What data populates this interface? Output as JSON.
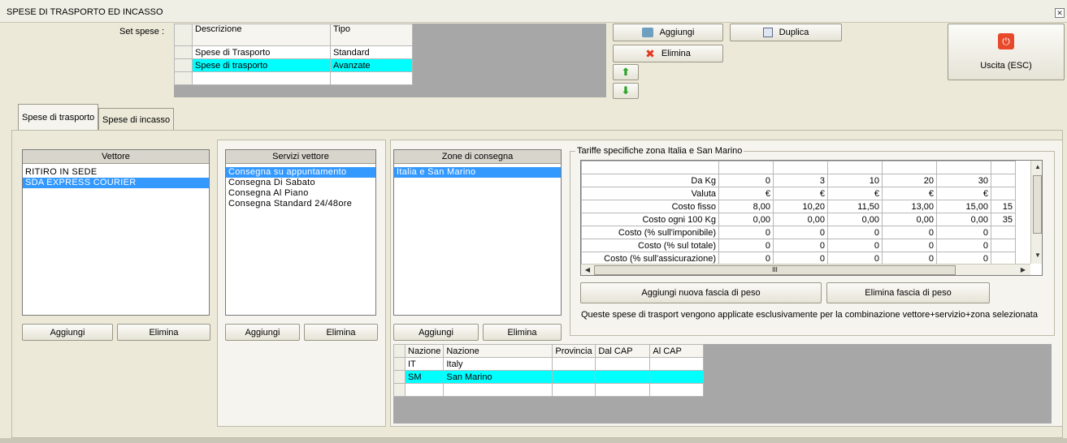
{
  "window": {
    "title": "SPESE DI TRASPORTO ED INCASSO"
  },
  "set_spese": {
    "label": "Set spese :",
    "columns": [
      "Descrizione",
      "Tipo"
    ],
    "rows": [
      {
        "descrizione": "Spese di Trasporto",
        "tipo": "Standard",
        "selected": false
      },
      {
        "descrizione": "Spese di trasporto",
        "tipo": "Avanzate",
        "selected": true
      }
    ]
  },
  "buttons": {
    "aggiungi": "Aggiungi",
    "elimina": "Elimina",
    "duplica": "Duplica",
    "uscita": "Uscita (ESC)"
  },
  "tabs": [
    "Spese di trasporto",
    "Spese di incasso"
  ],
  "vettore": {
    "header": "Vettore",
    "items": [
      "RITIRO IN SEDE",
      "SDA EXPRESS COURIER"
    ],
    "selected_index": 1,
    "add": "Aggiungi",
    "remove": "Elimina"
  },
  "servizi": {
    "header": "Servizi vettore",
    "items": [
      "Consegna su appuntamento",
      "Consegna Di Sabato",
      "Consegna Al Piano",
      "Consegna Standard 24/48ore"
    ],
    "selected_index": 0,
    "add": "Aggiungi",
    "remove": "Elimina"
  },
  "zone": {
    "header": "Zone di consegna",
    "items": [
      "Italia e San Marino"
    ],
    "selected_index": 0,
    "add": "Aggiungi",
    "remove": "Elimina"
  },
  "tariffe": {
    "group_title": "Tariffe specifiche zona Italia e San Marino",
    "rows": [
      {
        "label": "Da Kg",
        "values": [
          "0",
          "3",
          "10",
          "20",
          "30",
          ""
        ]
      },
      {
        "label": "Valuta",
        "values": [
          "€",
          "€",
          "€",
          "€",
          "€",
          ""
        ]
      },
      {
        "label": "Costo fisso",
        "values": [
          "8,00",
          "10,20",
          "11,50",
          "13,00",
          "15,00",
          "15"
        ]
      },
      {
        "label": "Costo ogni 100 Kg",
        "values": [
          "0,00",
          "0,00",
          "0,00",
          "0,00",
          "0,00",
          "35"
        ]
      },
      {
        "label": "Costo (% sull'imponibile)",
        "values": [
          "0",
          "0",
          "0",
          "0",
          "0",
          ""
        ]
      },
      {
        "label": "Costo (% sul totale)",
        "values": [
          "0",
          "0",
          "0",
          "0",
          "0",
          ""
        ]
      },
      {
        "label": "Costo (% sull'assicurazione)",
        "values": [
          "0",
          "0",
          "0",
          "0",
          "0",
          ""
        ]
      }
    ],
    "scroll_thumb": "III",
    "add_band": "Aggiungi nuova fascia di peso",
    "remove_band": "Elimina fascia di peso",
    "note": "Queste spese di trasport vengono applicate esclusivamente per la combinazione vettore+servizio+zona selezionata"
  },
  "nazioni": {
    "columns": [
      "Nazione",
      "Nazione",
      "Provincia",
      "Dal CAP",
      "Al CAP"
    ],
    "rows": [
      {
        "code": "IT",
        "name": "Italy",
        "selected": false
      },
      {
        "code": "SM",
        "name": "San Marino",
        "selected": true
      }
    ]
  },
  "colors": {
    "selection_cyan": "#00ffff",
    "selection_blue": "#3399ff",
    "exit_red": "#e8492b"
  }
}
